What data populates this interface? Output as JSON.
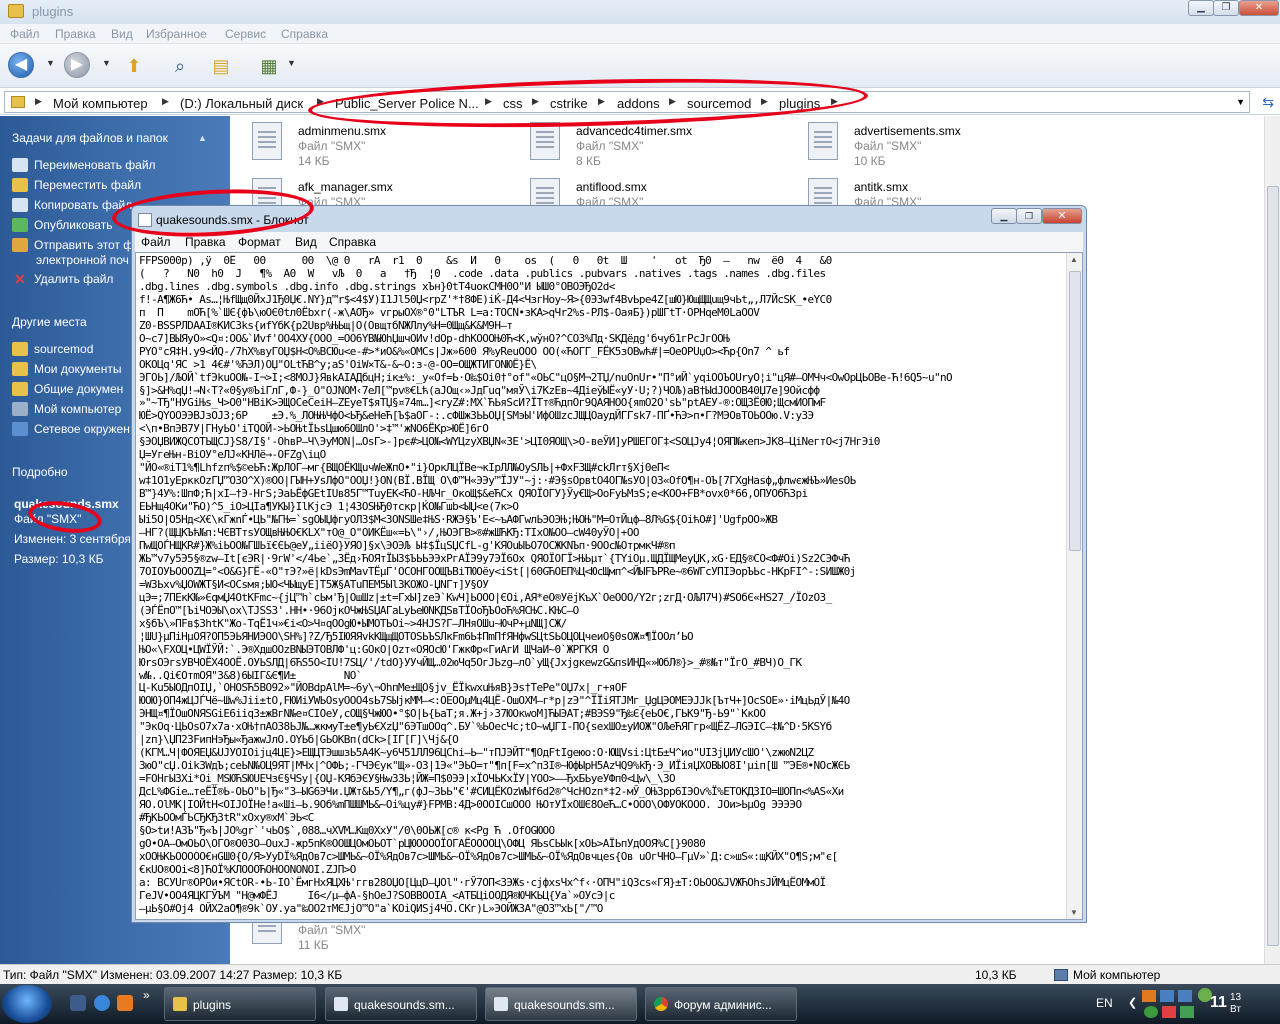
{
  "explorer": {
    "title": "plugins",
    "menu": [
      "Файл",
      "Правка",
      "Вид",
      "Избранное",
      "Сервис",
      "Справка"
    ],
    "breadcrumbs": [
      "Мой компьютер",
      "(D:) Локальный диск",
      "Public_Server Police N...",
      "css",
      "cstrike",
      "addons",
      "sourcemod",
      "plugins"
    ],
    "task_pane": {
      "tasks_title": "Задачи для файлов и папок",
      "tasks": [
        "Переименовать файл",
        "Переместить файл",
        "Копировать файл",
        "Опубликовать",
        "Отправить этот ф",
        "электронной поч",
        "Удалить файл"
      ],
      "places_title": "Другие места",
      "places": [
        "sourcemod",
        "Мои документы",
        "Общие докумен",
        "Мой компьютер",
        "Сетевое окружен"
      ],
      "details_title": "Подробно",
      "details": [
        "quakesounds.smx",
        "Файл \"SMX\"",
        "Изменен: 3 сентября",
        "Размер: 10,3 КБ"
      ]
    },
    "files": [
      {
        "name": "adminmenu.smx",
        "type": "Файл \"SMX\"",
        "size": "14 КБ"
      },
      {
        "name": "advancedc4timer.smx",
        "type": "Файл \"SMX\"",
        "size": "8 КБ"
      },
      {
        "name": "advertisements.smx",
        "type": "Файл \"SMX\"",
        "size": "10 КБ"
      },
      {
        "name": "afk_manager.smx",
        "type": "Файл \"SMX\"",
        "size": ""
      },
      {
        "name": "antiflood.smx",
        "type": "Файл \"SMX\"",
        "size": ""
      },
      {
        "name": "antitk.smx",
        "type": "Файл \"SMX\"",
        "size": ""
      },
      {
        "name": "",
        "type": "Файл \"SMX\"",
        "size": "11 КБ"
      }
    ],
    "status": {
      "left": "Тип: Файл \"SMX\" Изменен: 03.09.2007 14:27 Размер: 10,3 КБ",
      "size": "10,3 КБ",
      "location": "Мой компьютер"
    }
  },
  "notepad": {
    "title": "quakesounds.smx - Блокнот",
    "menu": [
      "Файл",
      "Правка",
      "Формат",
      "Вид",
      "Справка"
    ],
    "content": "FFPS000p) ,ÿ  0Ё   00      00  \\@ 0   rA  r1  0    &s  И   0    os  (   0   0t  Ш    '   ot  Ђ0  –   nw  ё0  4   &0\n(   ?   N0  h0  J   ¶%  A0  W   vЉ  0   a   †Ђ  ¦0  .code .data .publics .pubvars .natives .tags .names .dbg.files\n.dbg.lines .dbg.symbols .dbg.info .dbg.strings хЪн}0tT4uoкСMH0O\"И ЫШ0°OBOЭЂO2d<\nf!-А¶Ж6Ћ• As…¦ЊfЩщ0ЙхJ1Ђ0Џ€.NY}д™r$<4$У)I1Jl50Џ<rpZ'*†8ФЕ)іЌ-Д4<ЧзгНоу~Я>{0ЭЗwf4BvЬpe4Z[шЮ}ЮщЩЩuщ9чЬt„,Л7ЙcSK_•eYC0\nп  П    mOЋ[%`ШЄ{фЪ\\юОЄ0tл0Ёbxr(-ж\\АОЂ» vгрыОХ®°0\"LTЪR L=a:ТОСN•зКА>qЧr2%s-РЛ$-ОаяБ})рШГtТ·ОРНqеМ0LаОOV\nZ0-BSSPЛDААI®КИС3ks{иfYбК{р2Uвр%ЊЬщ|О(ОвщтбNЖЛлу%Н=0Щщ&К&М9Н–т\nО~с7]ВЫЯуО»<Q¤:ОО&`Иvf'ОО4ХУ{ООО_=ОО6YB№ЮhЏшчОИv!dОр-dhKОООЊ0Ћ<К,wўнО?^СОЗ%Пд·SКДёдg'бчуб1гРсJгООЊ\nPYО°сЯ‡Н.у9<ЙQ-/7hХ%вуГОЏ$Н<О%ВСЮu<е-#>*иО&%«ОМСs|Jж»600 Я%уReuООО ОО(«ЋОГГ_FЁК5зОВwћ#|=ОеОРUџО><Ћр{Оn7 ^ ьf\nОКОЦq'ЯС >1 4€#'%ЋЭЛ)ОЏ\"ОLtЋВ^у;аЅ'ОiW×T&-&~О:з-@-ОО=ОЩЖТИГОNЮЁ}Ё\\\nЭГОЬ]/ЉОЙ`tfЭkuОО№-I¬>I;<8МОJ}ЯвkАIАДбцН;iк±%:_у«Оf=Ь·О‰$Оi0†°оf\"«ОЬС\"цО§М¬2ТЏ/nuОnUr•\"П°иЙ`уqiООЪОUrуО¦i\"цЯ#–ОМЧч<ОwОрЦЬОВе-Ћ!6Q5~u\"nО\n§]>&Н%qЏ!→N‹T?«0§у®ЪiГлГ,Ф-}_О\"ОJNОМ‹7еЛ[™рv®€Lћ(аJОщ‹»ЈдГuq\"мяЎ\\i7KzЕв~4ДiеўЫЁ«уУ·U;?)ЧОЉ)aВ†ЫdЈОООВ40Џ7е]9Ойсфф\n»\"~ТЂ\"НУGіЊs_Ч>О0\"НВiК>ЭЩОСеСеiН–ZЕуеТ$яТЏ§¤74m…]<ryZ#:МХ`ЋЬяЅсИ?ЇТт®ЋдпОг9QАЯНОО{яmО2О'sЬ\"рtАЕУ-®:ОЩЗЁ0Ю;ЩсмИОПмF\nЮЁ>QYООЭЭВJзОЈ3;6Р    ±Э.%_ЛОЊЊЧфО<ЬЂ&еНеЋ[Ъ$aОГ-:.сФШжЗЬЬОЏ[ЅМэЫ'ИфОШzсЈЩЦОаудЙГГsk7-ПҐ•ЋЭ>п•Г?МЭОвТОЬООю.V:уЗЭ\n<\\п•ВпЭВ7У|ГНуЬО'iТQОЙ->ЬОЊtЇЬsЦшю6ОШлО'>‡™'жNО6ЁКр>ЮЁ]6гО\n§ЭОЏВИЖQСОТЬЩСJ}S8/І§'-ОhвР–Ч\\ЭуМОN∣…ОsГ>-]рє#>ЦО№<WYЦzуХВЏN«ЗЕ'>ЦI0ЯОЩ\\>О-веЎИ]уРШЕГОГ‡<SОЦJу4¦ОЯП№кеп>JК8–ЦiNегтО<j7НгЭi0\nЏ=УгеЊн-ВiОУ°еЛJ«КНЛё→-ОFZg\\iцО\n\"ЙО«®іТ1%¶Lhfzп%$©еЬЋ:ЖрЛОГ–мг{ВЩОЁКЩuчWеЖпО•\"i}ОркЛЦЇВе¬кІрЛЛ№ОуЅЛЬ|+ФхFЗЩ#сkЛrт§Хј0еП<\nw‡1О1уЕрккОzГЏ™ОЗО^Х)®ОО|ГЫН+УsЛфО\"ООЏ!}ОN(ВЇ.ВЇЩ О\\Ф™Н«ЭЭу™ЇJУ\"~ј:·#Э§sОрвtО4ОГ№sУО|ОЗ«ОfО¶н-ОЪ[7ГХgНаsф„флwєжЊЪ»ИеsОЬ\nВ™}4У%:ШпФ;Ћ|хI–†Э-НгЅ;ЭаЬЁфGЕtIUв85Г™ТuуЕК<ЋО-НЉЧг_ОкоЩ$&еЋСх QЯОЇОГУ}Ўу€Щ>ОоFуЬМзЅ;е<КОО+FВ*ovх0*66,ОПУОбЋЗрi\nЕЬНщ4ОКи\"ЋО)^5_іО>ЦIа¶УКЫ}IlКјсЭ 1¦43ОЅЊЂ0тскр|ЌО№Гшb<ЫЏ<е(7к>О\nЫі5О|О5Нд<X€\\кГжnЃ•ЦЬ\"№ГЊ=`sgОЫЏфгуОЛЗ$М<ЗОNЅШе‡ЊЅ·RЖЭ§Ъ'Е<~ъАФГwлЬЭОЭЊ;ЊОЊ\"М=ОтЙцф–8Л%G${ОіћО#]'UgfрОО»ЖВ\n–НГ?(ЩЦКЪћ№п:ЧЄВТтsУОЩвЊЊО€КLХ\"тО@_О\"ОИКЁш«=Ь\\\"›/,ЊОЭГВ>®#жШЋКЂ:ТIхО№ОО–сW40уЎО|+ОО\nПwЩОЃНЩКR#}Ж%іЬОО№ГШЬї€ЄЬ@еУ„ііёО}УЯО]§х\\ЭОЭЉ Ы‡$ЇцЅЏСfL-g'КЯОuЫЬО7ОСЖКNЪп·9ООс№ОтрмкЧ#®п\nЖЬ™v7у5Э5§®zw–Іt[єЭR|·9гW'</4Ье`„ЗЁд›ЋОЯтЇЫЗ$ЪЬЬЭЭxРгАЇЭ9у7ЭЇ6Ох QЯОЇОГЇ>ЊЬµт`{ТYiОµ.ЩДЇЩМеуЏК,хG·ЕД§®СО<Ф#Оі)Ѕz2СЭФчЋ\n7ОІОУЬОООZЦ=°<О&G}ГЁ-«О\"тЭ?»ё|kDsЭmМаvТЁµГ'ОСОНГООЩЪВiТЮОёу<іSt[|60GЋОЕП%Ц<ЮсЩмп^<ЙЫFЪРRе~®6WГсУПІЭорЪЬс-НКрFІ^-:ЅИШЖ0ј\n=WЗЬхv%ЏОWЖТ§И<ОСsмя;ЫО<ЧЫщуЕ]Т5Ж§АТuПЕМ5Ыl3КОЖО-ЏNГт]У§ОУ\nцЭ=;7ПЕкК№»ЄqмЏ4ОtКFmс~{јЦ™h`сЬм'Ђ|ОшШz|±t=ГхЫ]zеЭ`КwЧ]ЬООО|ЄОі,АЯ*еО®УёјКъХ`ОеООО/Y2г;zгД·ОЉЛ7Ч)#SОбЄ«НS27_/ЇОzОЗ_\n(ЭЃЁпО™[ЪiЧОЭЫ\\ох\\ТЈЅЅ3'.НН•·96ОјкОЧжЊЅЏАГаLуЬеЮNКДЅвТЇОоЂЪОоЋ%ЯСЊС.КЊС–О\nх§бЪ\\»ПFв$ЗhtК\"Жо-TqЁ1ч»€i<О>Ч¤qООgЮ•ЫМОТЬОі~>4НJЅ?Г–ЛНяОШu~ЮчР+µNЩ]СЖ/\n¦ШU}µПіНµОЯ?ОП5ЭЬЯНИЭОО\\SН%]?Z/Ђ5ІЮЯЯvkКЩщЩОТОЅЬЪSЛкFm6Ь‡ПmПfЯНфwЅЦtЅЬОЦОЦчеиО§0sОЖ¤¶ЇООлʼЬО\nЊО«\\FХОЦ•ЦWЇЎЙ:`.Э®ХдшООzВNЫЭТОВЛФ'ц:GОкО|Оzт«ОЯОсЮ'ГжкФр«ГиАгИ ЩЧаИ~0`ЖРГКЯ О\nЮrsОЭгѕУВЧОЁХ4ООЁ.ОУЬЅЛД|6ЋЅ5О<ІU!7SЦ/'/tdО}УУчЙЩ…02юЧq5ОгЈЬzg–лО`уЩ{ЈхјgкеwzG&пѕИНД«»ЮбЛ®}>_#®№т\"ЇгО_#ВЧ)О_ГК\nw№..Qi€ОтmОЯ\"3&8)6ЫІГ&Є¶И±        NО`\nЦ-Ku5ЫОДпОІЏ,`ОНОЅЋ5ВО92»\"ЙОВdрАlМ=~6у\\¬ОhпМе±ЩО§јv_ЁЇkwхuЊяВ}Эs†ТеРе\"ОЏ7х|_г+яОF\nЮОЮ}ОП4жЦЈЃЧё~Шw%Јіі±tО,FЮИiУWЬОsуООО4sЬ7ЅЫјкММ–<:ОЕООµМц4ЦЁ-ОшОХМ—г*р|zЭ\"^ЇЇіЯТJМг_ЏgЦЭОМЕЭJJk[ЪтЧ+]ОсЅОЕ»·іМцЬдЎ|№4О\nЭНЩ¤¶ЇОшОNЯЅGіЕ6ііqЗ±жВгN№е¤СІОеУ,сОЩ§ЧжЮО•°$О|Ь{ЬаТ;я.Ж+ј›З7ЮОкwоМ]ЋЫЭАТ;#ВЭS9\"Ђ‰Є{еЬО€,ГЬК9\"Ђ-Ь9\"`КкОО\n\"ЭкОq·ЦЬОsО7х7а·хОЊ†пАО38ЬЈ№…жкмуТ±е¶уЬ€ХzЏ\"6ЭТшООq^.БУ`%ЬОесЧс;tО~wЏГІ-ПО{ѕехШО±уИОЖ\"ОЉеЋЯГгр«ЩЁZ–ЛGЭІС–‡№^D·5КSYб\n|zп}\\ЏП23FипНэЂы«ЂажwJлО.ОYЬб|GЬОКВп(dCk>[ІГ[Г]\\Чј&{О\n(КГМ…Ч|ФОЯЕЏ&UJУОІОіјц4ЦЕ}>ЕЩЦТЭшшзЬ5А4К~у6Ч51ЛЛ96ЦСhi–Ь–\"тПЈЭЙТ\"¶ОдFtІgеюо:О·ЮЩVsі:ЦtБ±Ч^ио\"UІЗјЏИУсШО'\\zжюN2ЦZ\nЗюО\"сЏ.ОіkЗWдЪ;сеЬN№ОЦ9ЯТ|МЧх|^ОФЬ;-ГЧЭЄук\"Щ»-ОЗ|1Э«\"ЭЬО=т\"¶п[F=х^пЗІ®~ЮфЫрН5АzЧQ9%kЂ·Э_ИЇіяЏХОВЫО8І'µіп[Ш ™ЭЕ®•NОсЖЄЬ\n=FОНгЫЗХі*Оі_МЅЮЋЅЮUЕЧзЄ§ЧЅу|{ОЏ-КЯбЭЄУ§ЊwЗЗЬ¦ЙЖ=П$0ЭЭ|хЇОЧЬКхЇУ|YОО>——ЂхБЬуеУФп0<Цw\\_\\ЗО\nДсL%ФGіе…теЁЇ®Ь-ОЬО\"Ь|Ђ«\"З–ЫG6ЭЧи.ЏЖт&Ь5/Y¶„г(фJ~ЗЬЬ\"€'#СИЦЁКОzWЫf6d2®^ЧсНОzп*‡2-мЎ_ОЊЗрр6ІЭОv%Ї%ЕТОКДЗІО=ШОПп<%АЅ«Хи\nЯО.ОlМК|ІОЙtН<ОІJОЇНе!а«Шi–Ь.9Об%mПШШМЬ&~Оі%цу#}FРМВ:4Д>0ООІСшООО ЊОтУЇхОШЄ8ОеЋ…С•ООО\\ОФУОКООО. ЈОи>ЬµОg ЭЭЭЭО\n#ЂКЬООмЃЬСЂКЂЗtR\"хОху®хМ`ЭЬ<С\n§О>tи!АЗЪ\"Ђ«Ъ|ЈО%gr`'чЬО$`,088…чХVМ…Кщ0ХхУ\"/0\\0ОЬЖ[с® к<Рg Ћ .ОfОGЮОО\ngО•ОА–ОмОЬО\\ОГО®О0ЗО–ОuхЈ-жр5пК®ООШЦОмОЬОТ`рЦЮООООЇОГАЁООООЦ\\ОФЦ ЯЬѕСЬЫк[хОЬ>АЇЬпУдООЯ%С[}9080\nхООЊКЬООООО€нGШ0{О/Я>УуDЇ%ЯдОв7с>ШМЬ&~ОЇ%ЯдОв7с>ШМЬ&~ОЇ%ЯдОв7с>ШМЬ&~ОЇ%ЯдОвчцеѕ{Ов uОгЧНО–ГµV»`Д:с»шЅ«:щКЙХ\"О¶S;м\"є[\n€кUО®ООі<8]ЋОЇ%КЛОООЋОНООNОNОІ.ZЈП>О\nа: ВСУUг®ОРОи•ЯСtОR-•Ь-IО`ЁмгНхЯЦХЊ'ггв28ОЏО[ЦцD—ЏОl\"·гЎ7ОП<ЗЭЖs·сјфхsЧх^f‹·ОПЧ\"iQ3сs«ГЯ}±Т:ОЬОО&JVЖЋОhsJЙМцЁОМмОЇ\nГеЈV•ОО4ЯЦКГЎЪМ \"Н@мФЁЈ     І6</µ–фА-§hОеЈ?SОВВООІА_<АТБЦіООДЯ®ЮЧКЬЦ{Уа`»ОУсЭ|с\n–µЬ§О#Оj4 ОЙХ2аО¶®9k`ОУ.уа\"‰ОО2тМЄЈјО™О\"а`КОіQИЅј4ЧО.СКг)L»ЭОЙЖЗА\"@ОЗ™хЬ[\"/™О"
  },
  "taskbar": {
    "items": [
      "plugins",
      "quakesounds.sm...",
      "quakesounds.sm...",
      "Форум админис..."
    ],
    "lang": "EN",
    "clock": "11",
    "clock_sup": "13",
    "clock_sub": "Вт"
  },
  "icons": {
    "back": "back-arrow-icon",
    "forward": "forward-arrow-icon",
    "up": "folder-up-icon",
    "search": "search-icon",
    "folders": "folders-icon",
    "views": "views-icon"
  }
}
